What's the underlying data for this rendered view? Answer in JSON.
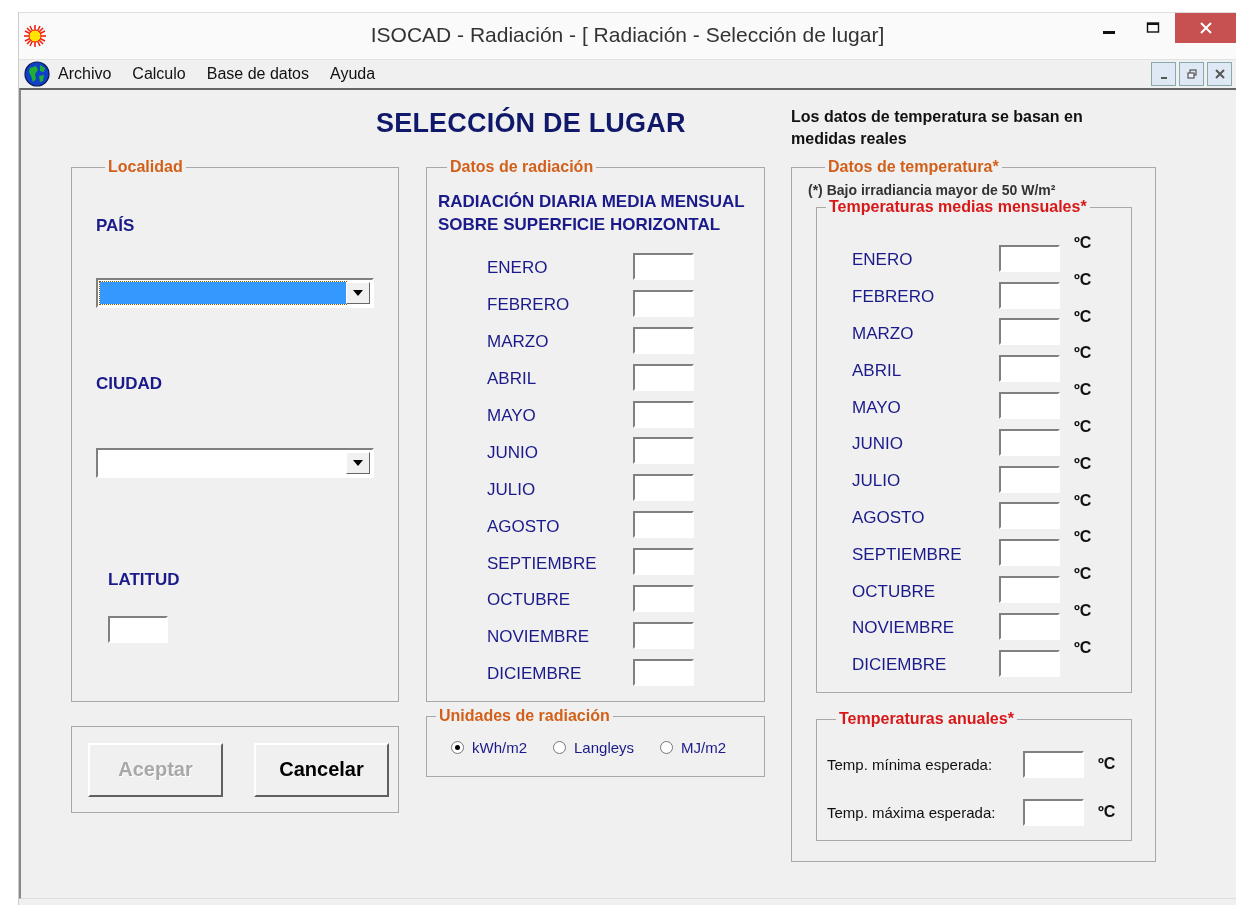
{
  "window": {
    "title": "ISOCAD - Radiación - [ Radiación - Selección de lugar]"
  },
  "menu": [
    "Archivo",
    "Calculo",
    "Base de datos",
    "Ayuda"
  ],
  "form_title": "SELECCIÓN DE LUGAR",
  "temperature_note": "Los datos de temperatura se basan en medidas reales",
  "location": {
    "title": "Localidad",
    "country_label": "PAÍS",
    "country_focused": true,
    "city_label": "CIUDAD",
    "latitude_label": "LATITUD"
  },
  "buttons": [
    {
      "label": "Aceptar",
      "disabled": true
    },
    {
      "label": "Cancelar",
      "disabled": false
    }
  ],
  "radiation": {
    "title": "Datos de radiación",
    "heading": "RADIACIÓN DIARIA MEDIA MENSUAL SOBRE SUPERFICIE HORIZONTAL",
    "months": [
      "ENERO",
      "FEBRERO",
      "MARZO",
      "ABRIL",
      "MAYO",
      "JUNIO",
      "JULIO",
      "AGOSTO",
      "SEPTIEMBRE",
      "OCTUBRE",
      "NOVIEMBRE",
      "DICIEMBRE"
    ]
  },
  "units": {
    "title": "Unidades de radiación",
    "options": [
      {
        "label": "kWh/m2",
        "selected": true
      },
      {
        "label": "Langleys",
        "selected": false
      },
      {
        "label": "MJ/m2",
        "selected": false
      }
    ]
  },
  "temperature": {
    "title": "Datos de temperatura*",
    "footnote": "(*) Bajo irradiancia mayor de 50 W/m²",
    "monthly": {
      "title": "Temperaturas medias mensuales*",
      "rows": [
        {
          "label": "ENERO",
          "unit": "ºC"
        },
        {
          "label": "FEBRERO",
          "unit": "ºC"
        },
        {
          "label": "MARZO",
          "unit": "ºC"
        },
        {
          "label": "ABRIL",
          "unit": "ºC"
        },
        {
          "label": "MAYO",
          "unit": "ºC"
        },
        {
          "label": "JUNIO",
          "unit": "ºC"
        },
        {
          "label": "JULIO",
          "unit": "ºC"
        },
        {
          "label": "AGOSTO",
          "unit": "ºC"
        },
        {
          "label": "SEPTIEMBRE",
          "unit": "ºC"
        },
        {
          "label": "OCTUBRE",
          "unit": "ºC"
        },
        {
          "label": "NOVIEMBRE",
          "unit": "ºC"
        },
        {
          "label": "DICIEMBRE",
          "unit": "ºC"
        }
      ]
    },
    "annual": {
      "title": "Temperaturas anuales*",
      "rows": [
        {
          "label": "Temp. mínima esperada:",
          "unit": "ºC"
        },
        {
          "label": "Temp. máxima esperada:",
          "unit": "ºC"
        }
      ]
    }
  }
}
